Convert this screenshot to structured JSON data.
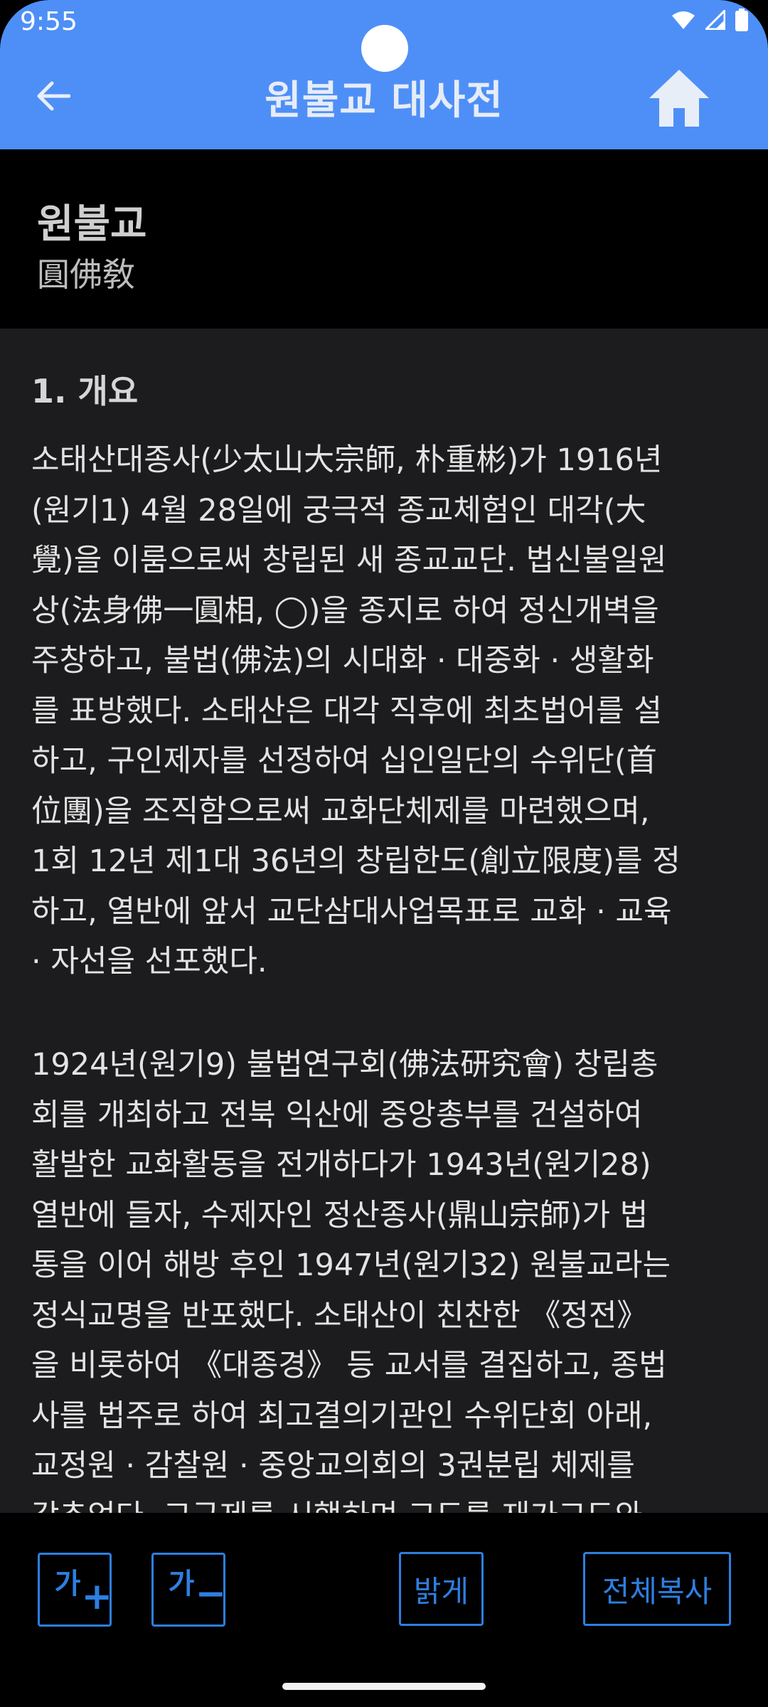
{
  "status": {
    "time": "9:55"
  },
  "appbar": {
    "title": "원불교 대사전"
  },
  "entry": {
    "headword": "원불교",
    "hanja": "圓佛敎"
  },
  "content": {
    "section_title": "1. 개요",
    "paragraph1": "소태산대종사(少太山大宗師, 朴重彬)가 1916년\n(원기1) 4월 28일에 궁극적 종교체험인 대각(大\n覺)을 이룸으로써 창립된 새 종교교단. 법신불일원\n상(法身佛一圓相, ◯)을 종지로 하여 정신개벽을\n주창하고, 불법(佛法)의 시대화 · 대중화 · 생활화\n를 표방했다. 소태산은 대각 직후에 최초법어를 설\n하고, 구인제자를 선정하여 십인일단의 수위단(首\n位團)을 조직함으로써 교화단체제를 마련했으며,\n1회 12년 제1대 36년의 창립한도(創立限度)를 정\n하고, 열반에 앞서 교단삼대사업목표로 교화 · 교육\n · 자선을 선포했다.",
    "paragraph2": "1924년(원기9) 불법연구회(佛法研究會) 창립총\n회를 개최하고 전북 익산에 중앙총부를 건설하여\n활발한 교화활동을 전개하다가 1943년(원기28)\n열반에 들자, 수제자인 정산종사(鼎山宗師)가 법\n통을 이어 해방 후인 1947년(원기32) 원불교라는\n정식교명을 반포했다. 소태산이 친찬한 《정전》\n을 비롯하여 《대종경》 등 교서를 결집하고, 종법\n사를 법주로 하여 최고결의기관인 수위단회 아래,\n교정원 · 감찰원 · 중앙교의회의 3권분립 체제를\n갖추었다. 교구제를 시행하며 교도를 재가교도와"
  },
  "toolbar": {
    "font_increase_glyph": "가",
    "font_increase_symbol": "+",
    "font_decrease_glyph": "가",
    "font_decrease_symbol": "−",
    "bright_label": "밝게",
    "copy_all_label": "전체복사"
  },
  "colors": {
    "appbar": "#4E8FF7",
    "content_bg": "#1C1C1E",
    "button_accent": "#2D7FE0"
  },
  "icons": [
    "back-arrow-icon",
    "home-icon",
    "wifi-icon",
    "signal-icon",
    "battery-icon"
  ]
}
